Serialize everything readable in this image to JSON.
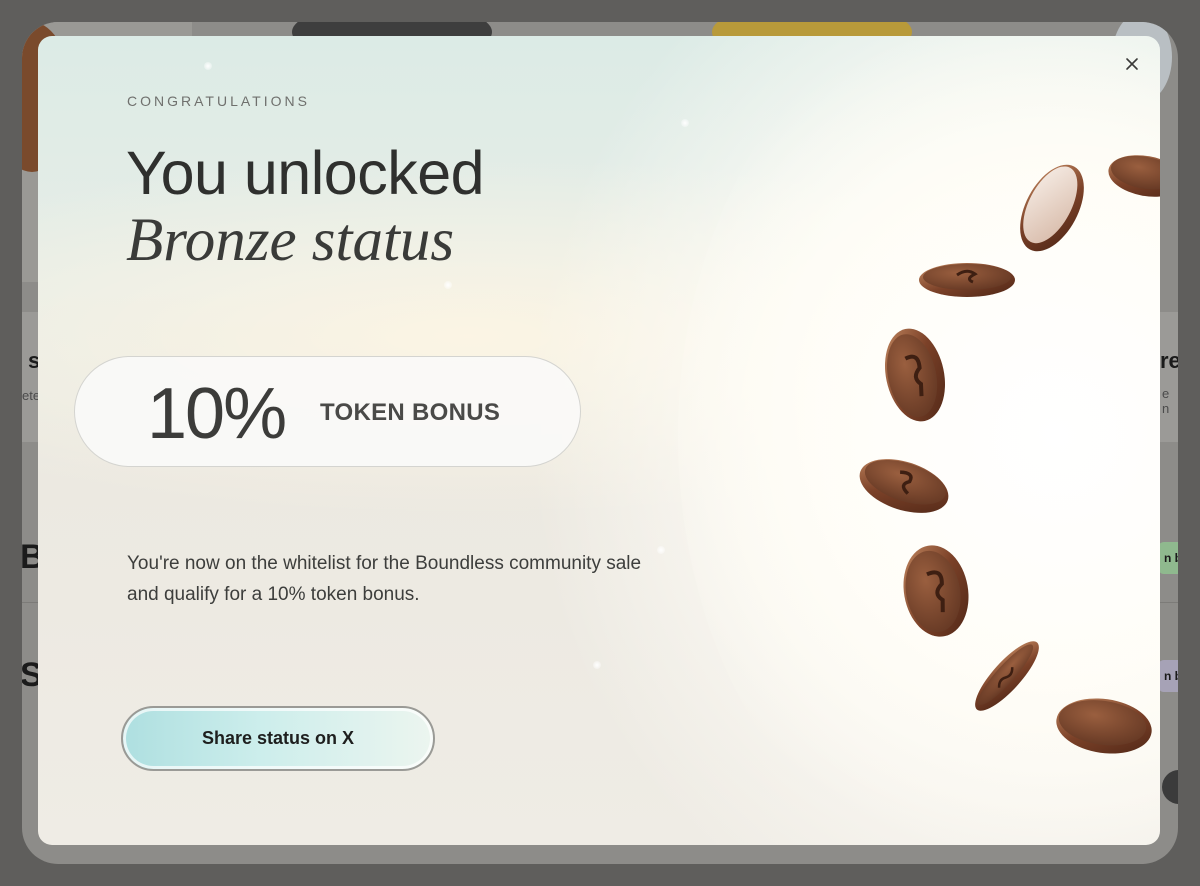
{
  "background_page": {
    "fragments": [
      "s",
      "ete",
      "re:",
      "e n",
      "B",
      "S",
      "n b",
      "n b"
    ]
  },
  "modal": {
    "close_icon": "close-icon",
    "eyebrow": "CONGRATULATIONS",
    "title_line1": "You unlocked",
    "title_line2": "Bronze status",
    "bonus": {
      "value": "10%",
      "label": "TOKEN BONUS"
    },
    "description": "You're now on the whitelist for the Boundless community sale and qualify for a 10% token bonus.",
    "share_button": "Share status on X",
    "illustration": "falling-bronze-coins",
    "colors": {
      "bronze": "#8a5236",
      "pill_bg": "#fafaf8",
      "button_gradient_start": "#aedfe0",
      "button_gradient_end": "#ecf5ef"
    }
  }
}
